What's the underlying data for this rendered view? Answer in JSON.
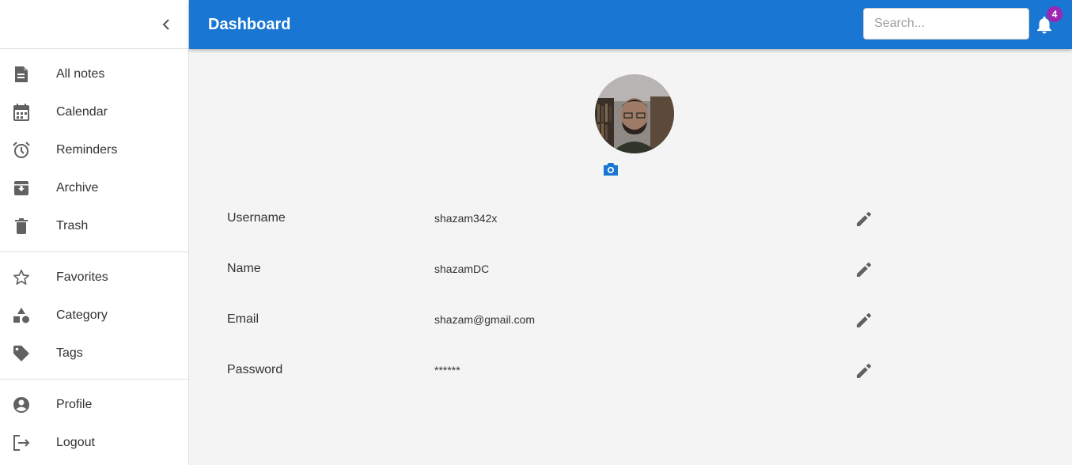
{
  "sidebar": {
    "groups": [
      [
        {
          "label": "All notes",
          "icon": "notes-icon"
        },
        {
          "label": "Calendar",
          "icon": "calendar-icon"
        },
        {
          "label": "Reminders",
          "icon": "alarm-clock-icon"
        },
        {
          "label": "Archive",
          "icon": "archive-icon"
        },
        {
          "label": "Trash",
          "icon": "trash-icon"
        }
      ],
      [
        {
          "label": "Favorites",
          "icon": "star-icon"
        },
        {
          "label": "Category",
          "icon": "category-shapes-icon"
        },
        {
          "label": "Tags",
          "icon": "tag-icon"
        }
      ],
      [
        {
          "label": "Profile",
          "icon": "account-circle-icon"
        },
        {
          "label": "Logout",
          "icon": "logout-icon"
        }
      ]
    ]
  },
  "header": {
    "title": "Dashboard",
    "search_placeholder": "Search...",
    "notification_count": "4"
  },
  "profile": {
    "fields": [
      {
        "label": "Username",
        "value": "shazam342x"
      },
      {
        "label": "Name",
        "value": "shazamDC"
      },
      {
        "label": "Email",
        "value": "shazam@gmail.com"
      },
      {
        "label": "Password",
        "value": "******"
      }
    ]
  },
  "colors": {
    "primary": "#1976d2",
    "badge": "#9c27b0",
    "icon": "#616161"
  }
}
